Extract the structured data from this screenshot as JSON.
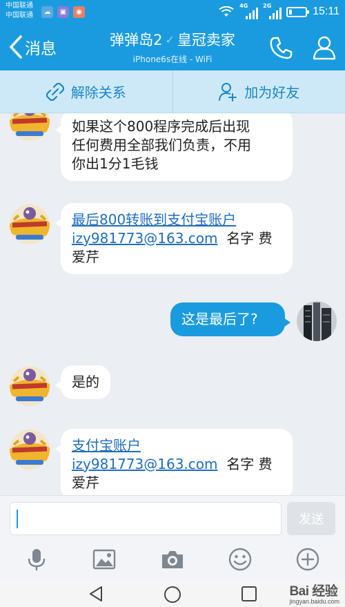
{
  "status_bar": {
    "carriers": [
      "中国联通",
      "中国联通"
    ],
    "network_labels": [
      "4G",
      "2G"
    ],
    "time": "15:11",
    "battery_fraction": 0.2
  },
  "header": {
    "back_label": "消息",
    "contact_name": "弹弹岛2",
    "verified_badge": "✓",
    "contact_title": "皇冠卖家",
    "status": "iPhone6s在线 - WiFi"
  },
  "actions": {
    "unlink": "解除关系",
    "add_friend": "加为好友"
  },
  "messages": [
    {
      "direction": "in",
      "lines": [
        "如果这个800程序完成后出现",
        "任何费用全部我们负责，不用",
        "你出1分1毛钱"
      ]
    },
    {
      "direction": "in",
      "link_lines": [
        "最后800转账到支付宝账户",
        "izy981773@163.com"
      ],
      "tail_after_link": "  名字 费",
      "last_line": "爱芹"
    },
    {
      "direction": "out",
      "text": "这是最后了?"
    },
    {
      "direction": "in",
      "text": "是的"
    },
    {
      "direction": "in",
      "link_lines": [
        "支付宝账户",
        "izy981773@163.com"
      ],
      "tail_after_link": "  名字 费",
      "last_line": "爱芹"
    }
  ],
  "input": {
    "value": "",
    "send_label": "发送"
  },
  "toolbar": [
    "microphone-icon",
    "image-icon",
    "camera-icon",
    "emoji-icon",
    "plus-icon"
  ],
  "watermark": {
    "main": "Bai 经验",
    "sub": "jingyan.baidu.com"
  },
  "colors": {
    "brand": "#1a9be0",
    "action_bar": "#cde9f8",
    "chat_bg": "#ebeef3",
    "link": "#1e6dc2"
  }
}
